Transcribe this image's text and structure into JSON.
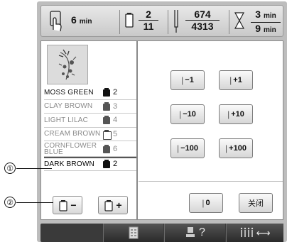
{
  "topbar": {
    "time": "6",
    "time_unit": "min",
    "color_current": "2",
    "color_total": "11",
    "stitch_current": "674",
    "stitch_total": "4313",
    "remain_time": "3",
    "remain_unit": "min",
    "total_time": "9",
    "total_unit": "min",
    "icons": [
      "hand-timer-icon",
      "spool-icon",
      "needle-icon",
      "hourglass-icon"
    ]
  },
  "colors": [
    {
      "name": "MOSS GREEN",
      "count": "2",
      "state": "current"
    },
    {
      "name": "CLAY BROWN",
      "count": "3",
      "state": "dim"
    },
    {
      "name": "LIGHT LILAC",
      "count": "4",
      "state": "dim"
    },
    {
      "name": "CREAM BROWN",
      "count": "5",
      "state": "dim-outline"
    },
    {
      "name": "CORNFLOWER BLUE",
      "count": "6",
      "state": "dim"
    },
    {
      "name": "DARK BROWN",
      "count": "2",
      "state": "next"
    }
  ],
  "buttons": {
    "minus1": "−1",
    "plus1": "+1",
    "minus10": "−10",
    "plus10": "+10",
    "minus100": "−100",
    "plus100": "+100",
    "zero": "0",
    "close": "关闭",
    "spool_minus": "−",
    "spool_plus": "+"
  },
  "bottombar": {
    "icons": [
      "checklist-icon",
      "needle-help-icon",
      "thread-tension-icon"
    ],
    "help_glyph": "?",
    "tension_glyph": "⟷"
  },
  "callouts": [
    "①",
    "②"
  ]
}
